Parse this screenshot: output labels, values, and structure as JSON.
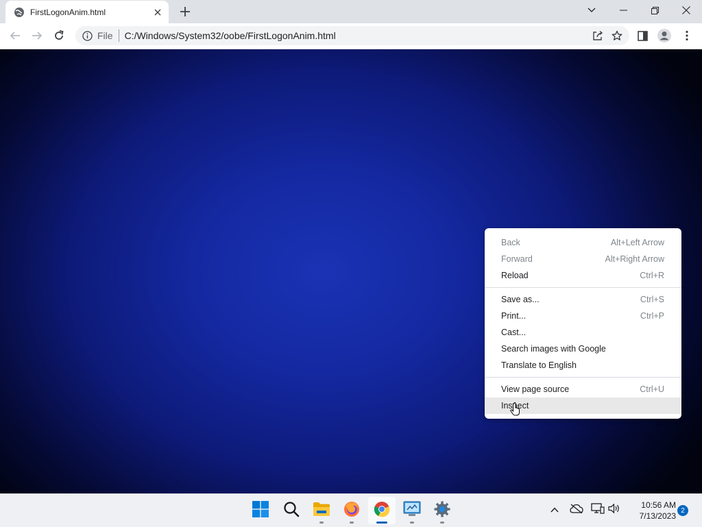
{
  "browser": {
    "tab": {
      "title": "FirstLogonAnim.html",
      "favicon": "globe-icon",
      "close_icon": "close-icon"
    },
    "new_tab_icon": "plus-icon",
    "window_controls": [
      "chevron-down-icon",
      "minimize-icon",
      "restore-icon",
      "close-icon"
    ],
    "toolbar": {
      "back_icon": "arrow-left-icon",
      "forward_icon": "arrow-right-icon",
      "reload_icon": "reload-icon",
      "omnibox": {
        "info_icon": "info-icon",
        "scheme_label": "File",
        "url": "C:/Windows/System32/oobe/FirstLogonAnim.html",
        "share_icon": "share-icon",
        "bookmark_icon": "star-icon"
      },
      "side_panel_icon": "side-panel-icon",
      "profile_icon": "profile-icon",
      "menu_icon": "kebab-menu-icon"
    }
  },
  "context_menu": {
    "groups": [
      [
        {
          "label": "Back",
          "shortcut": "Alt+Left Arrow",
          "disabled": true
        },
        {
          "label": "Forward",
          "shortcut": "Alt+Right Arrow",
          "disabled": true
        },
        {
          "label": "Reload",
          "shortcut": "Ctrl+R",
          "disabled": false
        }
      ],
      [
        {
          "label": "Save as...",
          "shortcut": "Ctrl+S",
          "disabled": false
        },
        {
          "label": "Print...",
          "shortcut": "Ctrl+P",
          "disabled": false
        },
        {
          "label": "Cast...",
          "shortcut": "",
          "disabled": false
        },
        {
          "label": "Search images with Google",
          "shortcut": "",
          "disabled": false
        },
        {
          "label": "Translate to English",
          "shortcut": "",
          "disabled": false
        }
      ],
      [
        {
          "label": "View page source",
          "shortcut": "Ctrl+U",
          "disabled": false
        },
        {
          "label": "Inspect",
          "shortcut": "",
          "disabled": false,
          "highlighted": true
        }
      ]
    ]
  },
  "taskbar": {
    "apps": [
      {
        "name": "start",
        "icon": "windows-logo-icon",
        "running": false,
        "active": false
      },
      {
        "name": "search",
        "icon": "search-icon",
        "running": false,
        "active": false
      },
      {
        "name": "file-explorer",
        "icon": "folder-icon",
        "running": true,
        "active": false
      },
      {
        "name": "firefox",
        "icon": "firefox-icon",
        "running": true,
        "active": false
      },
      {
        "name": "chrome",
        "icon": "chrome-icon",
        "running": true,
        "active": true
      },
      {
        "name": "control-panel",
        "icon": "control-panel-icon",
        "running": true,
        "active": false
      },
      {
        "name": "settings",
        "icon": "settings-gear-icon",
        "running": true,
        "active": false
      }
    ],
    "tray": {
      "icons": [
        "chevron-up-icon",
        "onedrive-offline-icon",
        "network-icon",
        "volume-icon"
      ],
      "time": "10:56 AM",
      "date": "7/13/2023",
      "notification_count": "2"
    }
  },
  "colors": {
    "page_gradient_center": "#1a33b5",
    "page_gradient_edge": "#01030f",
    "taskbar_active_indicator": "#005fb8",
    "notification_badge": "#0067c0"
  }
}
